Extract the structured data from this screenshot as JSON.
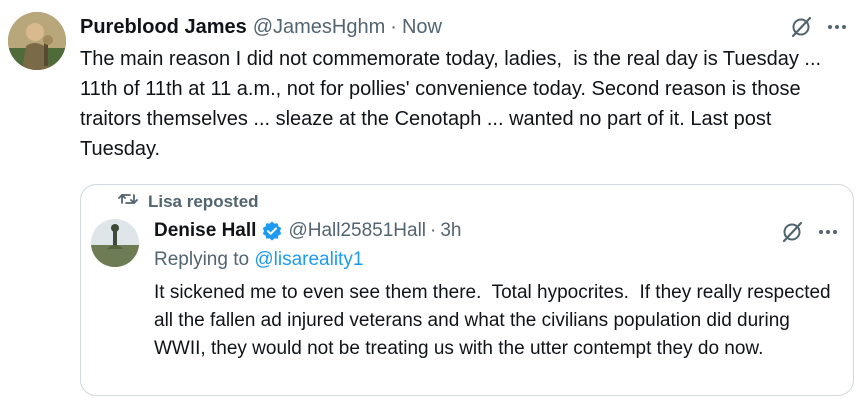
{
  "tweet": {
    "display_name": "Pureblood James",
    "handle": "@JamesHghm",
    "separator": "·",
    "time": "Now",
    "text": "The main reason I did not commemorate today, ladies,  is the real day is Tuesday ... 11th of 11th at 11 a.m., not for pollies' convenience today. Second reason is those traitors themselves ... sleaze at the Cenotaph ... wanted no part of it. Last post Tuesday."
  },
  "quoted": {
    "repost_label": "Lisa reposted",
    "display_name": "Denise Hall",
    "handle": "@Hall25851Hall",
    "separator": "·",
    "time": "3h",
    "replying_prefix": "Replying to ",
    "replying_handle": "@lisareality1",
    "text": "It sickened me to even see them there.  Total hypocrites.  If they really respected all the fallen ad injured veterans and what the civilians population did during WWII, they would not be treating us with the utter contempt they do now."
  },
  "icons": {
    "grok": "grok-icon",
    "more": "more-icon",
    "repost": "repost-icon",
    "verified": "verified-badge-icon"
  },
  "colors": {
    "text": "#0f1419",
    "muted": "#536471",
    "link": "#1d9bf0",
    "border": "#cfd9de"
  }
}
